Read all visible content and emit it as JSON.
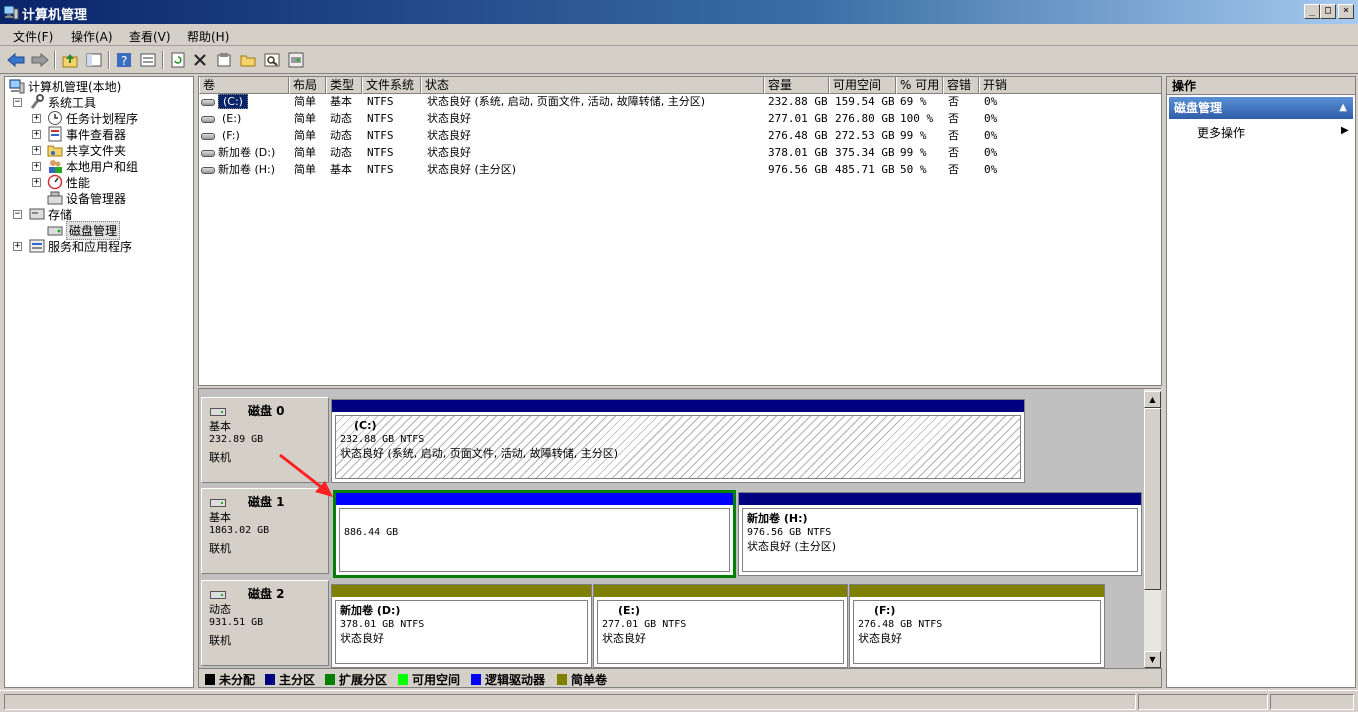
{
  "window": {
    "title": "计算机管理",
    "icon": "computer-management-icon"
  },
  "menu": [
    "文件(F)",
    "操作(A)",
    "查看(V)",
    "帮助(H)"
  ],
  "toolbar": {
    "icons": [
      "back-arrow-icon",
      "forward-arrow-icon",
      "up-folder-icon",
      "show-hide-tree-icon",
      "help-icon",
      "properties-view-icon",
      "refresh-icon",
      "delete-icon",
      "properties-icon",
      "open-icon",
      "search-icon",
      "rescan-disks-icon"
    ]
  },
  "tree": {
    "root": "计算机管理(本地)",
    "system_tools": "系统工具",
    "task_scheduler": "任务计划程序",
    "event_viewer": "事件查看器",
    "shared_folders": "共享文件夹",
    "local_users": "本地用户和组",
    "performance": "性能",
    "device_manager": "设备管理器",
    "storage": "存储",
    "disk_management": "磁盘管理",
    "services": "服务和应用程序"
  },
  "columns": [
    "卷",
    "布局",
    "类型",
    "文件系统",
    "状态",
    "容量",
    "可用空间",
    "% 可用",
    "容错",
    "开销"
  ],
  "volumes": [
    {
      "vol": "(C:)",
      "layout": "简单",
      "type": "基本",
      "fs": "NTFS",
      "status": "状态良好 (系统, 启动, 页面文件, 活动, 故障转储, 主分区)",
      "cap": "232.88 GB",
      "free": "159.54 GB",
      "pct": "69 %",
      "ft": "否",
      "ov": "0%"
    },
    {
      "vol": "(E:)",
      "layout": "简单",
      "type": "动态",
      "fs": "NTFS",
      "status": "状态良好",
      "cap": "277.01 GB",
      "free": "276.80 GB",
      "pct": "100 %",
      "ft": "否",
      "ov": "0%"
    },
    {
      "vol": "(F:)",
      "layout": "简单",
      "type": "动态",
      "fs": "NTFS",
      "status": "状态良好",
      "cap": "276.48 GB",
      "free": "272.53 GB",
      "pct": "99 %",
      "ft": "否",
      "ov": "0%"
    },
    {
      "vol": "新加卷 (D:)",
      "layout": "简单",
      "type": "动态",
      "fs": "NTFS",
      "status": "状态良好",
      "cap": "378.01 GB",
      "free": "375.34 GB",
      "pct": "99 %",
      "ft": "否",
      "ov": "0%"
    },
    {
      "vol": "新加卷 (H:)",
      "layout": "简单",
      "type": "基本",
      "fs": "NTFS",
      "status": "状态良好 (主分区)",
      "cap": "976.56 GB",
      "free": "485.71 GB",
      "pct": "50 %",
      "ft": "否",
      "ov": "0%"
    }
  ],
  "disks": [
    {
      "name": "磁盘 0",
      "kind": "基本",
      "size": "232.89 GB",
      "state": "联机",
      "parts": [
        {
          "name": "(C:)",
          "size": "232.88 GB NTFS",
          "status": "状态良好 (系统, 启动, 页面文件, 活动, 故障转储, 主分区)"
        }
      ]
    },
    {
      "name": "磁盘 1",
      "kind": "基本",
      "size": "1863.02 GB",
      "state": "联机",
      "parts": [
        {
          "name": "",
          "size": "886.44 GB",
          "status": ""
        },
        {
          "name": "新加卷 (H:)",
          "size": "976.56 GB NTFS",
          "status": "状态良好 (主分区)"
        }
      ]
    },
    {
      "name": "磁盘 2",
      "kind": "动态",
      "size": "931.51 GB",
      "state": "联机",
      "parts": [
        {
          "name": "新加卷 (D:)",
          "size": "378.01 GB NTFS",
          "status": "状态良好"
        },
        {
          "name": "(E:)",
          "size": "277.01 GB NTFS",
          "status": "状态良好"
        },
        {
          "name": "(F:)",
          "size": "276.48 GB NTFS",
          "status": "状态良好"
        }
      ]
    }
  ],
  "legend": [
    {
      "label": "未分配",
      "color": "#000000"
    },
    {
      "label": "主分区",
      "color": "#000080"
    },
    {
      "label": "扩展分区",
      "color": "#008000"
    },
    {
      "label": "可用空间",
      "color": "#00ff00"
    },
    {
      "label": "逻辑驱动器",
      "color": "#0000ff"
    },
    {
      "label": "简单卷",
      "color": "#808000"
    }
  ],
  "actions": {
    "header": "操作",
    "section": "磁盘管理",
    "more": "更多操作"
  },
  "colors": {
    "primary_bar": "#000080",
    "free_space_bar": "#0000ff",
    "simple_bar": "#808000",
    "selection_border": "#008000",
    "annotation_arrow": "#ff2020"
  }
}
